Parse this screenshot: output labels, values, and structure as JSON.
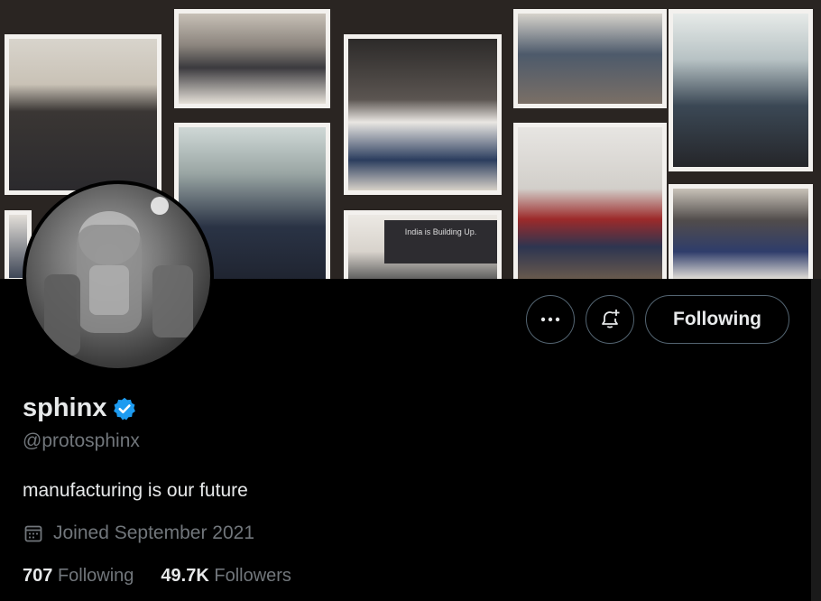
{
  "profile": {
    "display_name": "sphinx",
    "handle": "@protosphinx",
    "bio": "manufacturing is our future",
    "joined": "Joined September 2021",
    "verified": true
  },
  "stats": {
    "following_count": "707",
    "following_label": "Following",
    "followers_count": "49.7K",
    "followers_label": "Followers"
  },
  "actions": {
    "more_icon": "more-icon",
    "notify_icon": "bell-plus-icon",
    "following_button": "Following"
  },
  "banner": {
    "projector_text": "India is Building Up."
  },
  "colors": {
    "background": "#000000",
    "text_primary": "#e7e9ea",
    "text_secondary": "#71767b",
    "border": "#536471",
    "verified_badge": "#1d9bf0"
  }
}
